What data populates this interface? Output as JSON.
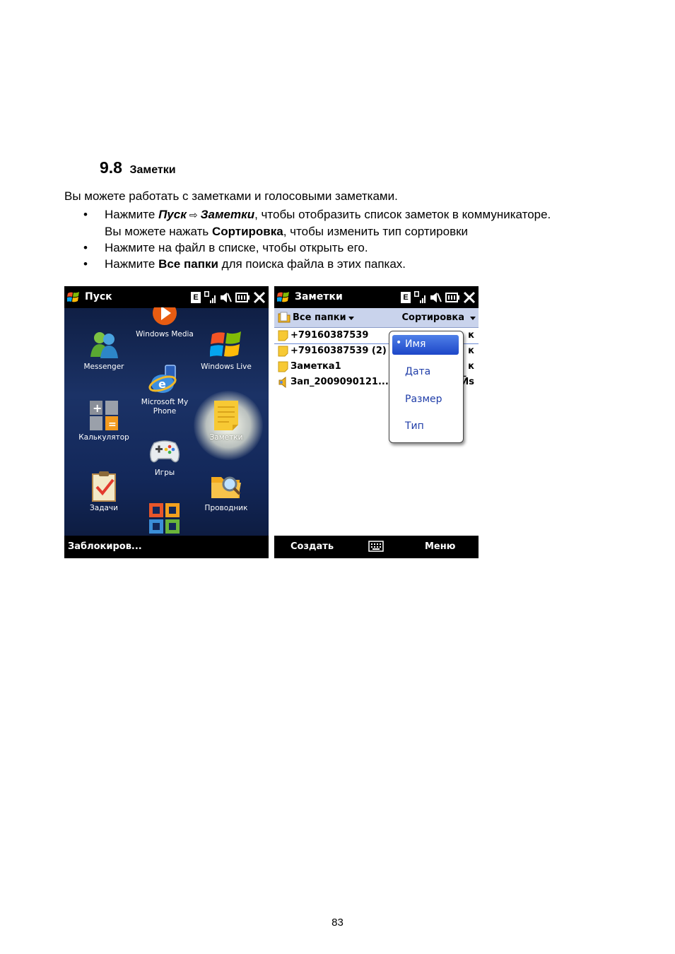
{
  "section": {
    "number": "9.8",
    "title": "Заметки"
  },
  "intro": "Вы можете работать с заметками и голосовыми заметками.",
  "bullets": [
    {
      "t1": "Нажмите ",
      "b1": "Пуск",
      "arrow": "⇨",
      "b2": "Заметки",
      "t2": ", чтобы отобразить список заметок в коммуникаторе.",
      "l2a": "Вы можете нажать ",
      "l2b": "Сортировка",
      "l2c": ", чтобы изменить тип сортировки"
    },
    {
      "text": "Нажмите на файл в списке, чтобы открыть его."
    },
    {
      "t1": "Нажмите ",
      "b1": "Все папки",
      "t2": " для поиска файла в этих папках."
    }
  ],
  "start_screen": {
    "title": "Пуск",
    "status_badge": "E",
    "apps": [
      {
        "label": "Windows Media",
        "icon": "windows-media-icon"
      },
      {
        "label": "Messenger",
        "icon": "messenger-icon"
      },
      {
        "label": "Windows Live",
        "icon": "windows-live-icon"
      },
      {
        "label": "Microsoft My Phone",
        "icon": "my-phone-icon"
      },
      {
        "label": "Калькулятор",
        "icon": "calculator-icon"
      },
      {
        "label": "Заметки",
        "icon": "notes-icon"
      },
      {
        "label": "Игры",
        "icon": "gamepad-icon"
      },
      {
        "label": "Задачи",
        "icon": "tasks-icon"
      },
      {
        "label": "Проводник",
        "icon": "explorer-icon"
      },
      {
        "label": "",
        "icon": "office-icon"
      }
    ],
    "softkey_left": "Заблокиров..."
  },
  "notes_screen": {
    "title": "Заметки",
    "status_badge": "E",
    "folder_label": "Все папки",
    "sort_label": "Сортировка",
    "notes": [
      {
        "name": "+79160387539",
        "right": "к",
        "type": "note"
      },
      {
        "name": "+79160387539 (2)",
        "right": "к",
        "type": "note"
      },
      {
        "name": "Заметка1",
        "right": "к",
        "type": "note"
      },
      {
        "name": "Зап_2009090121...",
        "right": "Ӣs",
        "type": "voice"
      }
    ],
    "sort_menu": [
      "Имя",
      "Дата",
      "Размер",
      "Тип"
    ],
    "sort_selected": "Имя",
    "softkey_left": "Создать",
    "softkey_right": "Меню"
  },
  "page_number": "83"
}
